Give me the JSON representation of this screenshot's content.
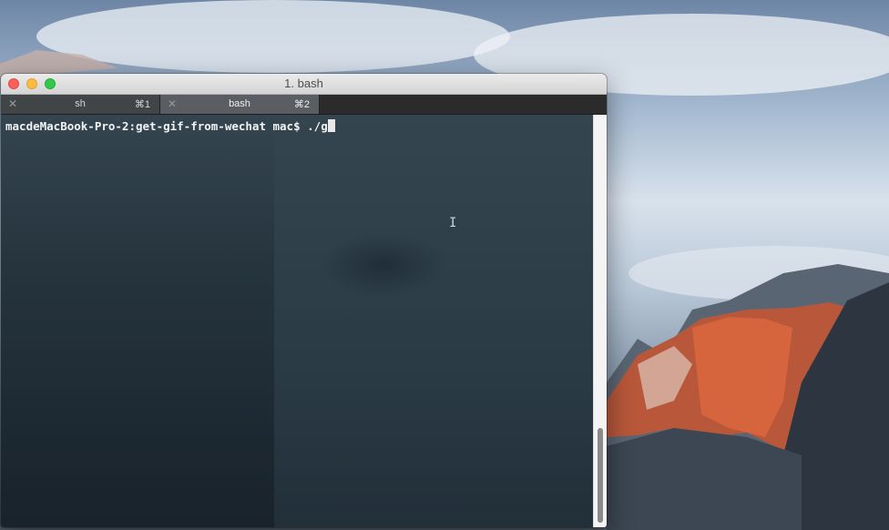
{
  "window": {
    "title": "1. bash"
  },
  "tabs": [
    {
      "label": "sh",
      "shortcut": "⌘1",
      "close_glyph": "✕",
      "active": false
    },
    {
      "label": "bash",
      "shortcut": "⌘2",
      "close_glyph": "✕",
      "active": true
    }
  ],
  "terminal": {
    "prompt": "macdeMacBook-Pro-2:get-gif-from-wechat mac$ ",
    "command": "./g",
    "text_cursor_glyph": "I"
  },
  "colors": {
    "close": "#fc605b",
    "minimize": "#fdbc40",
    "maximize": "#34c84a",
    "terminal_text": "#f2f2f2"
  }
}
